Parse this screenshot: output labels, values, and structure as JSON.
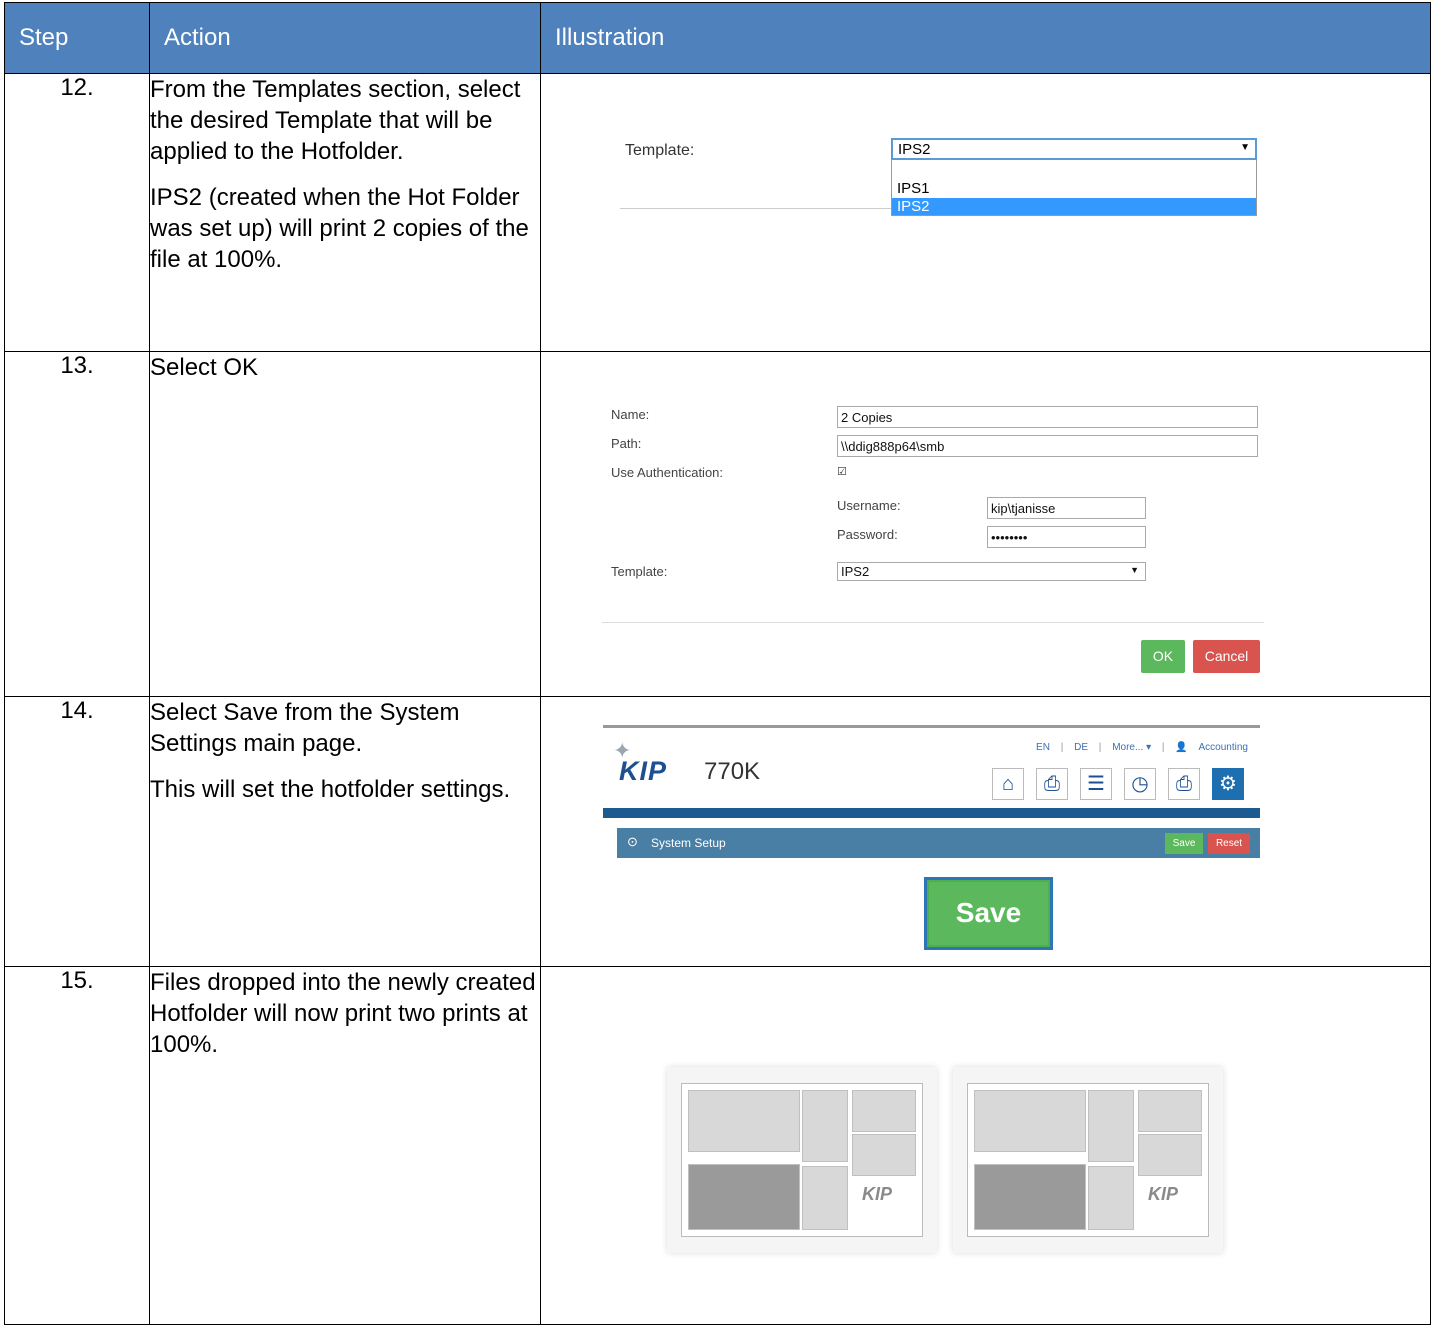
{
  "headers": {
    "step": "Step",
    "action": "Action",
    "illustration": "Illustration"
  },
  "rows": [
    {
      "step": "12.",
      "action": [
        "From the Templates section, select the desired Template that will be applied to the Hotfolder.",
        "IPS2 (created when the Hot Folder was set up) will print 2 copies of the file at 100%."
      ],
      "template_label": "Template:",
      "template_selected": "IPS2",
      "template_options": [
        "IPS1",
        "IPS2"
      ]
    },
    {
      "step": "13.",
      "action": [
        "Select OK"
      ],
      "form": {
        "name_label": "Name:",
        "name_value": "2 Copies",
        "path_label": "Path:",
        "path_value": "\\\\ddig888p64\\smb",
        "auth_label": "Use Authentication:",
        "auth_checked": true,
        "username_label": "Username:",
        "username_value": "kip\\tjanisse",
        "password_label": "Password:",
        "password_value": "••••••••",
        "template_label": "Template:",
        "template_value": "IPS2",
        "ok_label": "OK",
        "cancel_label": "Cancel"
      }
    },
    {
      "step": "14.",
      "action": [
        "Select Save from the System Settings main page.",
        "This will set the hotfolder settings."
      ],
      "kip": {
        "logo": "KIP",
        "model": "770K",
        "nav_en": "EN",
        "nav_de": "DE",
        "nav_more": "More... ▾",
        "nav_accounting": "Accounting",
        "bar_title": "System Setup",
        "save_label": "Save",
        "reset_label": "Reset",
        "big_save_label": "Save"
      }
    },
    {
      "step": "15.",
      "action": [
        "Files dropped into the newly created Hotfolder will now print two prints at 100%."
      ],
      "thumb_logo": "KIP"
    }
  ]
}
